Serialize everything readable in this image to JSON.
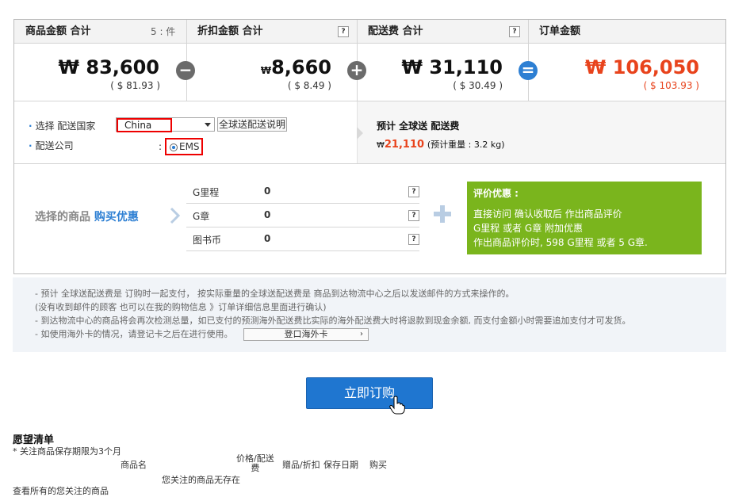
{
  "summary": {
    "product_total_label": "商品金额 合计",
    "product_count": "5 : 件",
    "product_total_amount": "₩ 83,600",
    "product_total_usd": "( $ 81.93 )",
    "discount_label": "折扣金额 合计",
    "discount_amount": "8,660",
    "discount_currency": "₩",
    "discount_usd": "( $ 8.49 )",
    "shipping_label": "配送费 合计",
    "shipping_amount": "₩ 31,110",
    "shipping_usd": "( $ 30.49 )",
    "order_total_label": "订单金额",
    "order_total_amount": "₩ 106,050",
    "order_total_usd": "( $ 103.93 )",
    "help_mark": "?",
    "op_minus": "−",
    "op_plus": "+",
    "op_equal": "="
  },
  "shipping": {
    "country_label": "选择 配送国家",
    "country_value": "China",
    "country_help_button": "全球送配送说明",
    "company_label": "配送公司",
    "company_colon": ":",
    "company_value": "EMS",
    "estimate_title": "预计 全球送 配送费",
    "estimate_currency": "₩",
    "estimate_amount": "21,110",
    "estimate_weight": "(预计重量 : 3.2 kg)"
  },
  "promo": {
    "title_prefix": "选择的商品",
    "title_highlight": "购买优惠",
    "rows": [
      {
        "name": "G里程",
        "value": "0"
      },
      {
        "name": "G章",
        "value": "0"
      },
      {
        "name": "图书币",
        "value": "0"
      }
    ],
    "review_title": "评价优惠 :",
    "review_lines": [
      "直接访问 确认收取后 作出商品评价",
      "G里程 或者 G章 附加优惠",
      "作出商品评价时, 598 G里程 或者 5 G章."
    ]
  },
  "notes": {
    "lines": [
      "- 预计 全球送配送费是 订购时一起支付， 按实际重量的全球送配送费是 商品到达物流中心之后以发送邮件的方式来操作的。",
      "(没有收到邮件的顾客 也可以在我的购物信息 》订单详细信息里面进行确认)",
      "- 到达物流中心的商品将会再次检测总量，如已支付的预测海外配送费比实际的海外配送费大时将退款到现金余额, 而支付金额小时需要追加支付才可发货。",
      "- 如使用海外卡的情况，请登记卡之后在进行使用。"
    ],
    "card_button": "登口海外卡",
    "card_chevron": "›"
  },
  "order_button": "立即订购",
  "wishlist": {
    "title": "愿望清单",
    "note": "* 关注商品保存期限为3个月",
    "col_name": "商品名",
    "col_price_1": "价格/配送",
    "col_price_2": "费",
    "col_gift": "赠品/折扣",
    "col_save": "保存日期",
    "col_buy": "购买",
    "empty": "您关注的商品无存在",
    "view_all": "查看所有的您关注的商品"
  },
  "colors": {
    "accent_blue": "#2d7fd3",
    "total_red": "#e8431c",
    "promo_green": "#7ab51d",
    "highlight_red": "#ee0000"
  }
}
